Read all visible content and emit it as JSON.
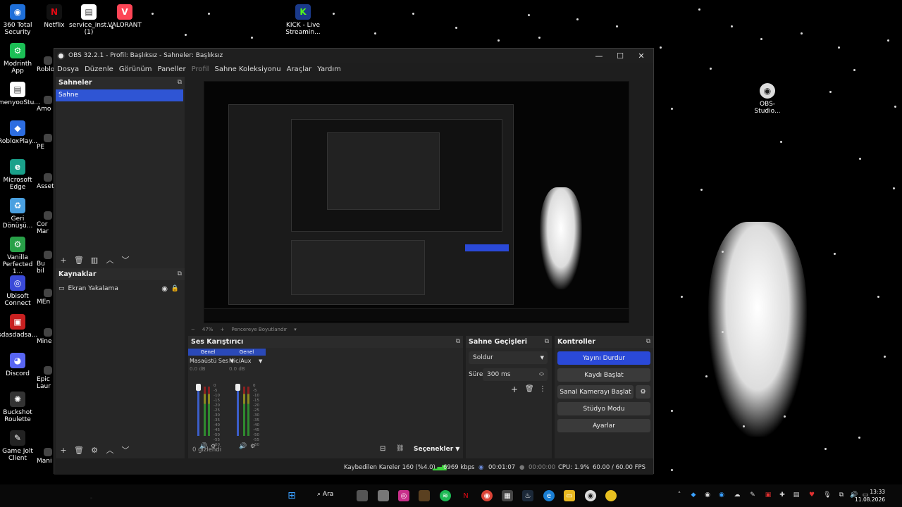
{
  "desktop": {
    "icons_left": [
      {
        "label": "360 Total Security",
        "color": "#1e6fd9",
        "glyph": "◉"
      },
      {
        "label": "Modrinth App",
        "color": "#1bbf55",
        "glyph": "⚙"
      },
      {
        "label": "menyooStu...",
        "color": "#ffffff",
        "glyph": "▤"
      },
      {
        "label": "RobloxPlay...",
        "color": "#2d6de0",
        "glyph": "◆"
      },
      {
        "label": "Microsoft Edge",
        "color": "#1aa08a",
        "glyph": "e"
      },
      {
        "label": "Geri Dönüşü...",
        "color": "#4aa0e0",
        "glyph": "♻"
      },
      {
        "label": "Vanilla Perfected 1...",
        "color": "#28a048",
        "glyph": "⚙"
      },
      {
        "label": "Ubisoft Connect",
        "color": "#3a4ad8",
        "glyph": "◎"
      },
      {
        "label": "sdasdadsa...",
        "color": "#c82020",
        "glyph": "▣"
      },
      {
        "label": "Discord",
        "color": "#5865f2",
        "glyph": "◕"
      },
      {
        "label": "Buckshot Roulette",
        "color": "#333333",
        "glyph": "✺"
      },
      {
        "label": "Game Jolt Client",
        "color": "#222222",
        "glyph": "✎"
      }
    ],
    "icons_col2": [
      "Roblo",
      "Amo",
      "PE",
      "Asset",
      "Cor Mar",
      "Bu bil",
      "MEn",
      "Mine",
      "Epic Laur",
      "Mani"
    ],
    "icons_top": [
      {
        "label": "Netflix",
        "color": "#e50914",
        "glyph": "N"
      },
      {
        "label": "service_inst... (1)",
        "color": "#ffffff",
        "glyph": "▤"
      },
      {
        "label": "VALORANT",
        "color": "#fd4556",
        "glyph": "V"
      },
      {
        "label": "KICK - Live Streamin...",
        "color": "#53fc18",
        "glyph": "K"
      }
    ],
    "icon_right": {
      "label": "OBS-Studio...",
      "color": "#eeeeee",
      "glyph": "◉"
    }
  },
  "obs": {
    "title": "OBS 32.2.1 - Profil: Başlıksız - Sahneler: Başlıksız",
    "menu": [
      "Dosya",
      "Düzenle",
      "Görünüm",
      "Paneller",
      "Profil",
      "Sahne Koleksiyonu",
      "Araçlar",
      "Yardım"
    ],
    "scenes": {
      "title": "Sahneler",
      "items": [
        "Sahne"
      ]
    },
    "sources": {
      "title": "Kaynaklar",
      "items": [
        "Ekran Yakalama"
      ]
    },
    "zoom": {
      "value": "47%",
      "fit_label": "Pencereye Boyutlandır"
    },
    "mixer": {
      "title": "Ses Karıştırıcı",
      "channels": [
        {
          "tag": "Genel",
          "name": "Masaüstü Ses",
          "db": "0.0 dB"
        },
        {
          "tag": "Genel",
          "name": "Mic/Aux",
          "db": "0.0 dB"
        }
      ],
      "ticks": [
        "0",
        "-5",
        "-10",
        "-15",
        "-20",
        "-25",
        "-30",
        "-35",
        "-40",
        "-45",
        "-50",
        "-55",
        "-60"
      ],
      "hidden_label": "0 gizlendi",
      "options_label": "Seçenekler"
    },
    "transitions": {
      "title": "Sahne Geçişleri",
      "selected": "Soldur",
      "duration_label": "Süre",
      "duration_value": "300 ms"
    },
    "controls": {
      "title": "Kontroller",
      "buttons": [
        "Yayını Durdur",
        "Kaydı Başlat",
        "Sanal Kamerayı Başlat",
        "Stüdyo Modu",
        "Ayarlar"
      ]
    },
    "status": {
      "dropped": "Kaybedilen Kareler 160 (%4.0)",
      "bitrate": "6969 kbps",
      "stream_time": "00:01:07",
      "rec_time": "00:00:00",
      "cpu": "CPU: 1.9%",
      "fps": "60.00 / 60.00 FPS"
    }
  },
  "taskbar": {
    "search_label": "Ara",
    "time": "13:33",
    "date": "11.08.2026"
  }
}
